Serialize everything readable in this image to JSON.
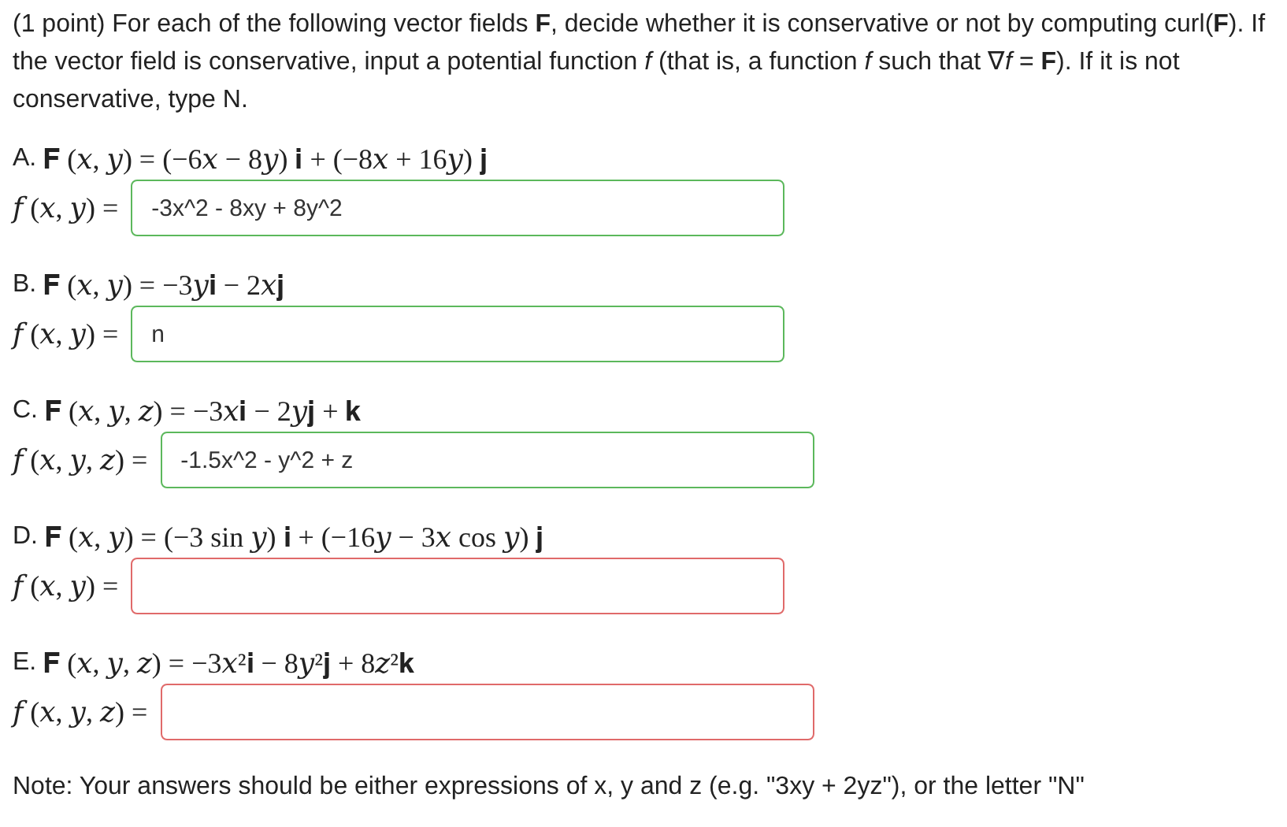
{
  "intro": "(1 point) For each of the following vector fields **F**, decide whether it is conservative or not by computing curl(**F**). If the vector field is conservative, input a potential function *f* (that is, a function *f* such that ∇*f* = **F**). If it is not conservative, type N.",
  "parts": [
    {
      "label": "A.",
      "field": "𝐅 (𝑥, 𝑦) = (−6𝑥 − 8𝑦) 𝐢 + (−8𝑥 + 16𝑦) 𝐣",
      "answer_label": "𝑓 (𝑥, 𝑦) =",
      "value": "-3x^2 - 8xy + 8y^2",
      "correct": true
    },
    {
      "label": "B.",
      "field": "𝐅 (𝑥, 𝑦) = −3𝑦𝐢 − 2𝑥𝐣",
      "answer_label": "𝑓 (𝑥, 𝑦) =",
      "value": "n",
      "correct": true
    },
    {
      "label": "C.",
      "field": "𝐅 (𝑥, 𝑦, 𝑧) = −3𝑥𝐢 − 2𝑦𝐣 + 𝐤",
      "answer_label": "𝑓 (𝑥, 𝑦, 𝑧) =",
      "value": "-1.5x^2 - y^2 + z",
      "correct": true
    },
    {
      "label": "D.",
      "field": "𝐅 (𝑥, 𝑦) = (−3 sin 𝑦) 𝐢 + (−16𝑦 − 3𝑥 cos 𝑦) 𝐣",
      "answer_label": "𝑓 (𝑥, 𝑦) =",
      "correct": false
    },
    {
      "label": "E.",
      "field": "𝐅 (𝑥, 𝑦, 𝑧) = −3𝑥²𝐢 − 8𝑦²𝐣 + 8𝑧²𝐤",
      "answer_label": "𝑓 (𝑥, 𝑦, 𝑧) =",
      "correct": false
    }
  ],
  "note": "Note: Your answers should be either expressions of x, y and z (e.g. \"3xy + 2yz\"), or the letter \"N\""
}
